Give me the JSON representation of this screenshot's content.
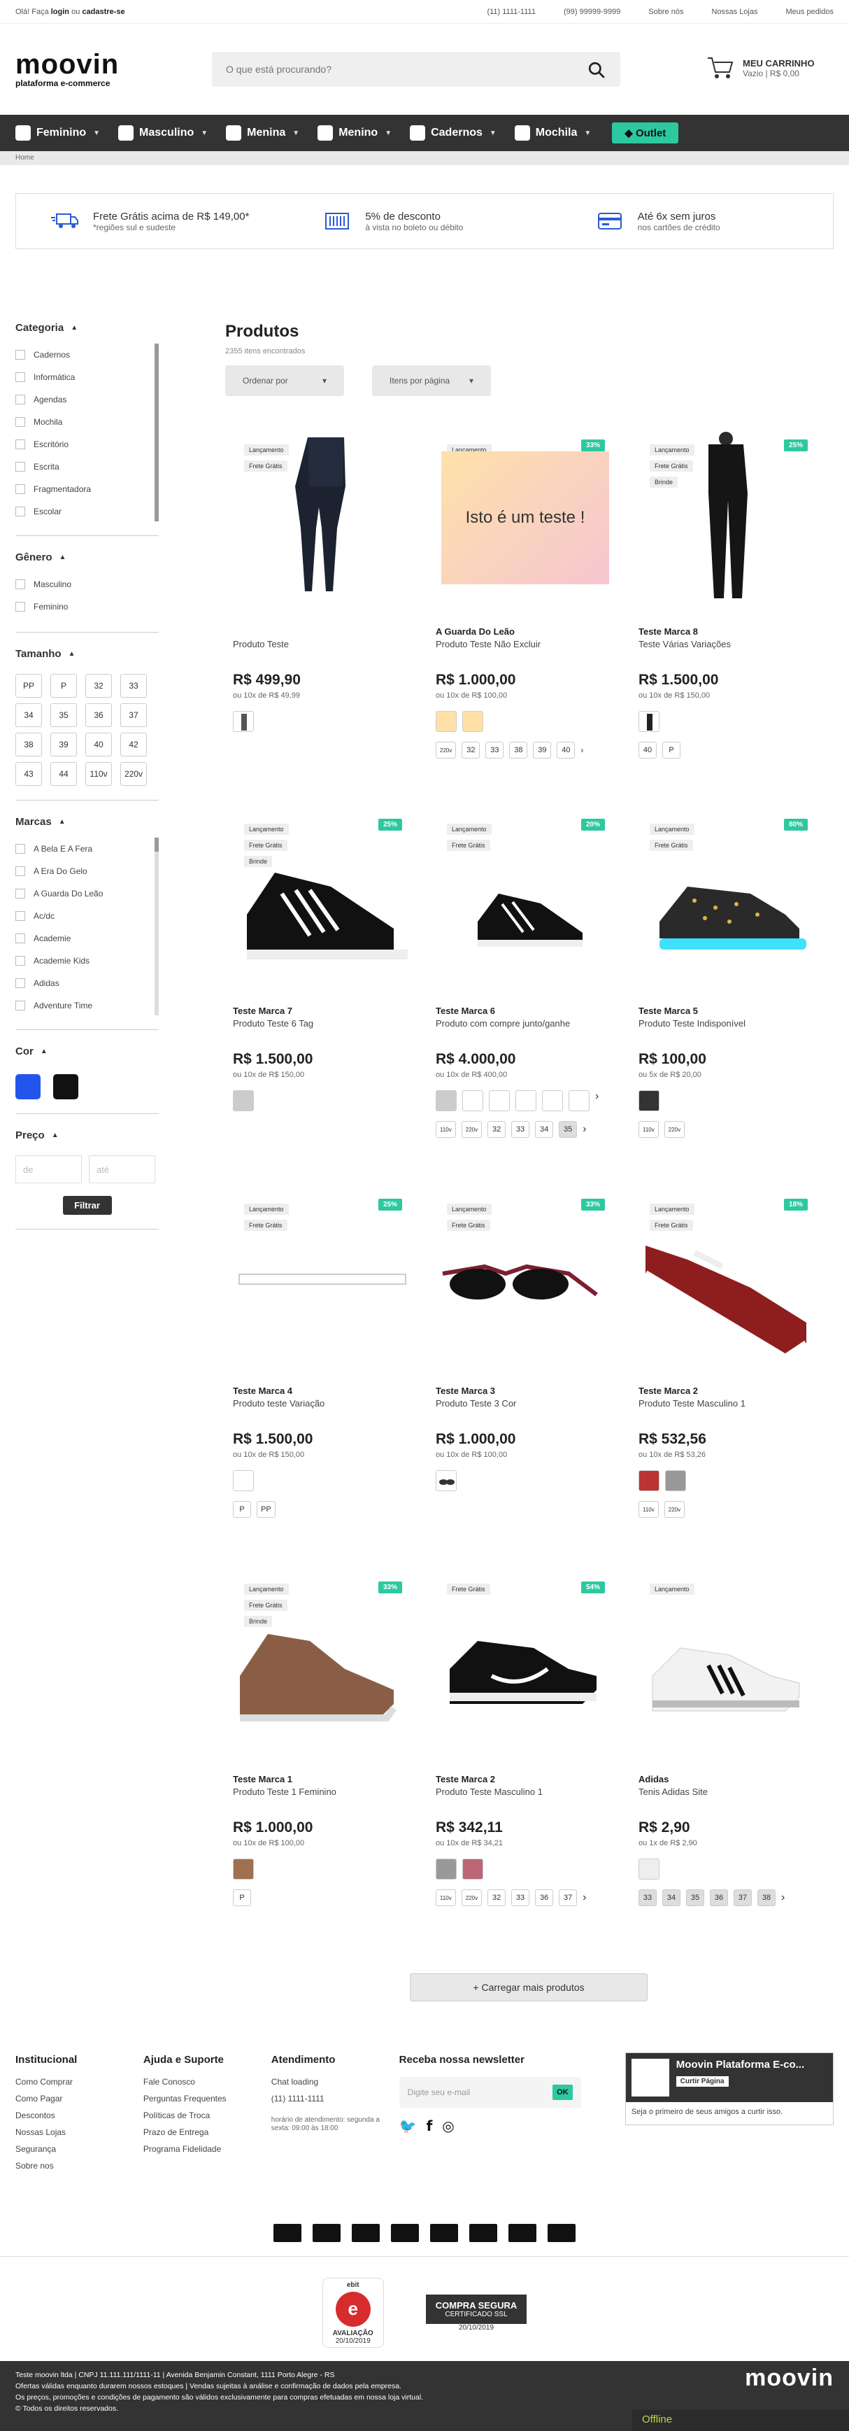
{
  "topbar": {
    "greeting_prefix": "Olá! Faça",
    "login": "login",
    "or": "ou",
    "signup": "cadastre-se",
    "phone1": "(11) 1111-1111",
    "phone2": "(99) 99999-9999",
    "about": "Sobre nós",
    "stores": "Nossas Lojas",
    "orders": "Meus pedidos"
  },
  "header": {
    "logo_word": "moovin",
    "logo_sub": "plataforma e-commerce",
    "search_placeholder": "O que está procurando?",
    "cart_title": "MEU CARRINHO",
    "cart_status": "Vazio | R$ 0,00"
  },
  "nav": {
    "items": [
      "Feminino",
      "Masculino",
      "Menina",
      "Menino",
      "Cadernos",
      "Mochila"
    ],
    "outlet": "Outlet"
  },
  "breadcrumb": "Home",
  "benefits": [
    {
      "title": "Frete Grátis acima de R$ 149,00*",
      "sub": "*regiões sul e sudeste"
    },
    {
      "title": "5% de desconto",
      "sub": "à vista no boleto ou débito"
    },
    {
      "title": "Até 6x sem juros",
      "sub": "nos cartões de crédito"
    }
  ],
  "filters": {
    "category_title": "Categoria",
    "categories": [
      "Cadernos",
      "Informática",
      "Agendas",
      "Mochila",
      "Escritório",
      "Escrita",
      "Fragmentadora",
      "Escolar"
    ],
    "gender_title": "Gênero",
    "genders": [
      "Masculino",
      "Feminino"
    ],
    "size_title": "Tamanho",
    "sizes": [
      "PP",
      "P",
      "32",
      "33",
      "34",
      "35",
      "36",
      "37",
      "38",
      "39",
      "40",
      "42",
      "43",
      "44",
      "110v",
      "220v"
    ],
    "brands_title": "Marcas",
    "brands": [
      "A Bela E A Fera",
      "A Era Do Gelo",
      "A Guarda Do Leão",
      "Ac/dc",
      "Academie",
      "Academie Kids",
      "Adidas",
      "Adventure Time"
    ],
    "color_title": "Cor",
    "colors": [
      "#2255ee",
      "#111111"
    ],
    "price_title": "Preço",
    "price_from": "de",
    "price_to": "até",
    "filter_button": "Filtrar"
  },
  "products_title": "Produtos",
  "products_count": "2355 itens encontrados",
  "sort_label": "Ordenar por",
  "perpage_label": "Itens por página",
  "badges": {
    "new": "Lançamento",
    "free": "Frete Grátis",
    "gift": "Brinde"
  },
  "products": [
    {
      "brand": "",
      "name": "Produto Teste",
      "price": "R$ 499,90",
      "inst": "ou 10x de R$ 49,99",
      "discount": "",
      "vars": []
    },
    {
      "brand": "A Guarda Do Leão",
      "name": "Produto Teste Não Excluir",
      "price": "R$ 1.000,00",
      "inst": "ou 10x de R$ 100,00",
      "discount": "33%",
      "img_text": "Isto é um teste !",
      "vars": [
        "220v",
        "32",
        "33",
        "38",
        "39",
        "40"
      ]
    },
    {
      "brand": "Teste Marca 8",
      "name": "Teste Várias Variações",
      "price": "R$ 1.500,00",
      "inst": "ou 10x de R$ 150,00",
      "discount": "25%",
      "vars": [
        "40",
        "P"
      ]
    },
    {
      "brand": "Teste Marca 7",
      "name": "Produto Teste 6 Tag",
      "price": "R$ 1.500,00",
      "inst": "ou 10x de R$ 150,00",
      "discount": "25%",
      "vars": []
    },
    {
      "brand": "Teste Marca 6",
      "name": "Produto com compre junto/ganhe",
      "price": "R$ 4.000,00",
      "inst": "ou 10x de R$ 400,00",
      "discount": "20%",
      "vars": [
        "110v",
        "220v",
        "32",
        "33",
        "34",
        "35"
      ]
    },
    {
      "brand": "Teste Marca 5",
      "name": "Produto Teste Indisponível",
      "price": "R$ 100,00",
      "inst": "ou 5x de R$ 20,00",
      "discount": "80%",
      "vars": [
        "110v",
        "220v"
      ]
    },
    {
      "brand": "Teste Marca 4",
      "name": "Produto teste Variação",
      "price": "R$ 1.500,00",
      "inst": "ou 10x de R$ 150,00",
      "discount": "25%",
      "vars": [
        "P",
        "PP"
      ]
    },
    {
      "brand": "Teste Marca 3",
      "name": "Produto Teste 3 Cor",
      "price": "R$ 1.000,00",
      "inst": "ou 10x de R$ 100,00",
      "discount": "33%",
      "vars": []
    },
    {
      "brand": "Teste Marca 2",
      "name": "Produto Teste Masculino 1",
      "price": "R$ 532,56",
      "inst": "ou 10x de R$ 53,26",
      "discount": "18%",
      "vars": [
        "110v",
        "220v"
      ]
    },
    {
      "brand": "Teste Marca 1",
      "name": "Produto Teste 1 Feminino",
      "price": "R$ 1.000,00",
      "inst": "ou 10x de R$ 100,00",
      "discount": "33%",
      "vars": [
        "P"
      ]
    },
    {
      "brand": "Teste Marca 2",
      "name": "Produto Teste Masculino 1",
      "price": "R$ 342,11",
      "inst": "ou 10x de R$ 34,21",
      "discount": "54%",
      "vars": [
        "110v",
        "220v",
        "32",
        "33",
        "36",
        "37"
      ]
    },
    {
      "brand": "Adidas",
      "name": "Tenis Adidas Site",
      "price": "R$ 2,90",
      "inst": "ou 1x de R$ 2,90",
      "discount": "",
      "vars": [
        "33",
        "34",
        "35",
        "36",
        "37",
        "38"
      ]
    }
  ],
  "load_more": "+ Carregar mais produtos",
  "footer": {
    "inst_title": "Institucional",
    "inst_links": [
      "Como Comprar",
      "Como Pagar",
      "Descontos",
      "Nossas Lojas",
      "Segurança",
      "Sobre nos"
    ],
    "help_title": "Ajuda e Suporte",
    "help_links": [
      "Fale Conosco",
      "Perguntas Frequentes",
      "Políticas de Troca",
      "Prazo de Entrega",
      "Programa Fidelidade"
    ],
    "att_title": "Atendimento",
    "att_links": [
      "Chat loading",
      "(11) 1111-1111"
    ],
    "hours": "horário de atendimento: segunda a sexta: 09:00 às 18:00",
    "news_title": "Receba nossa newsletter",
    "news_placeholder": "Digite seu e-mail",
    "ok": "OK",
    "fb_title": "Moovin Plataforma E-co...",
    "fb_like": "Curtir Página",
    "fb_text": "Seja o primeiro de seus amigos a curtir isso.",
    "seal1_top": "ebit",
    "seal1_mid": "AVALIAÇÃO",
    "seal1_date": "20/10/2019",
    "seal2_title": "COMPRA SEGURA",
    "seal2_sub": "CERTIFICADO SSL",
    "seal2_date": "20/10/2019"
  },
  "bottom": {
    "line1": "Teste moovin ltda | CNPJ 11.111.111/1111-11 | Avenida Benjamin Constant, 1111 Porto Alegre - RS",
    "line2": "Ofertas válidas enquanto durarem nossos estoques | Vendas sujeitas à análise e confirmação de dados pela empresa.",
    "line3": "Os preços, promoções e condições de pagamento são válidos exclusivamente para compras efetuadas em nossa loja virtual.",
    "line4": "© Todos os direitos reservados.",
    "logo": "moovin",
    "offline": "Offline"
  }
}
